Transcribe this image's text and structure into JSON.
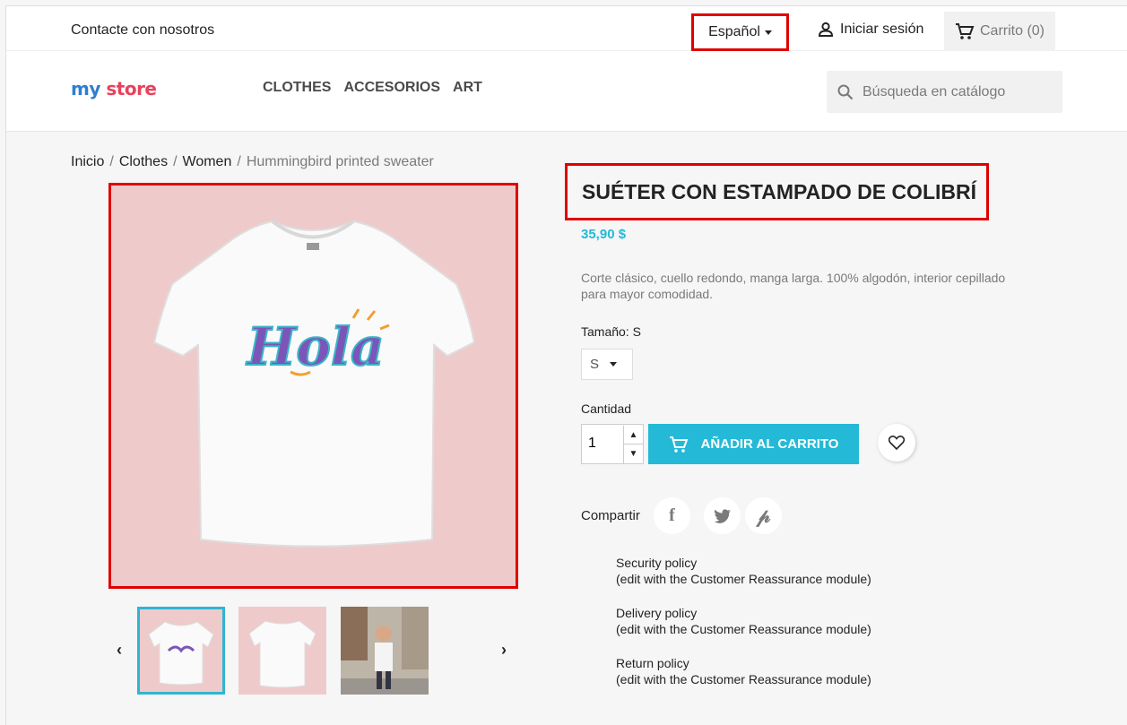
{
  "topbar": {
    "contact": "Contacte con nosotros",
    "language": "Español",
    "login": "Iniciar sesión",
    "cart": "Carrito (0)"
  },
  "header": {
    "logo_part1": "my",
    "logo_part2": "store",
    "nav": [
      "CLOTHES",
      "ACCESORIOS",
      "ART"
    ],
    "search_placeholder": "Búsqueda en catálogo"
  },
  "breadcrumb": {
    "items": [
      "Inicio",
      "Clothes",
      "Women"
    ],
    "separator": "/",
    "current": "Hummingbird printed sweater"
  },
  "product": {
    "title": "SUÉTER CON ESTAMPADO DE COLIBRÍ",
    "price": "35,90 $",
    "description": "Corte clásico, cuello redondo, manga larga. 100% algodón, interior cepillado para mayor comodidad.",
    "size_label": "Tamaño: S",
    "size_value": "S",
    "quantity_label": "Cantidad",
    "quantity_value": "1",
    "add_to_cart": "AÑADIR AL CARRITO",
    "shirt_text": "Hola",
    "share_label": "Compartir"
  },
  "reassurance": [
    {
      "title": "Security policy",
      "subtitle": "(edit with the Customer Reassurance module)"
    },
    {
      "title": "Delivery policy",
      "subtitle": "(edit with the Customer Reassurance module)"
    },
    {
      "title": "Return policy",
      "subtitle": "(edit with the Customer Reassurance module)"
    }
  ],
  "colors": {
    "accent": "#24b9d7",
    "highlight": "#e00000",
    "image_bg": "#efcaca"
  },
  "icons": {
    "language_caret": "caret-down-icon",
    "login": "user-icon",
    "cart": "cart-icon",
    "search": "search-icon",
    "prev": "chevron-left-icon",
    "next": "chevron-right-icon",
    "wishlist": "heart-icon",
    "facebook": "facebook-icon",
    "twitter": "twitter-icon",
    "pinterest": "pinterest-icon"
  }
}
